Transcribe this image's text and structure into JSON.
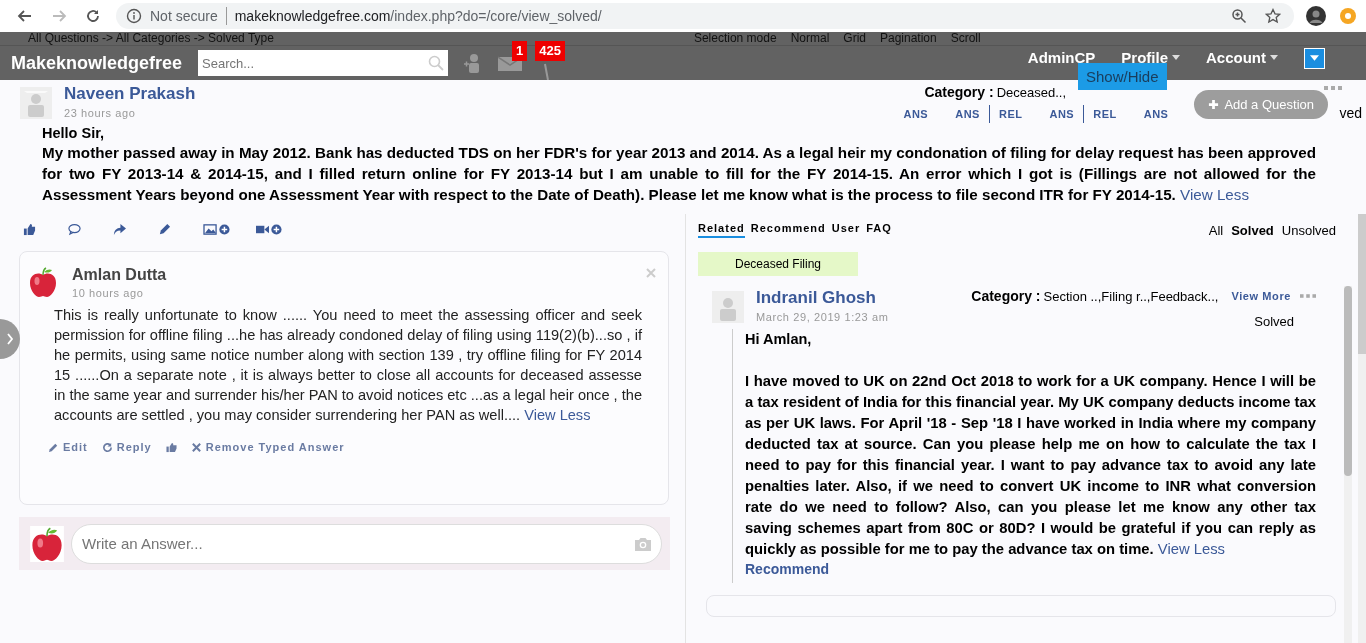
{
  "browser": {
    "security": "Not secure",
    "url_host": "makeknowledgefree.com",
    "url_path": "/index.php?do=/core/view_solved/"
  },
  "navbar": {
    "breadcrumb": "All Questions -> All Categories -> Solved Type",
    "view_options": [
      "Selection mode",
      "Normal",
      "Grid",
      "Pagination",
      "Scroll"
    ],
    "brand": "Makeknowledgefree",
    "search": {
      "placeholder": "Search..."
    },
    "badges": [
      "1",
      "425"
    ],
    "menu": [
      {
        "label": "AdminCP",
        "dropdown": false
      },
      {
        "label": "Profile",
        "dropdown": true
      },
      {
        "label": "Account",
        "dropdown": true
      }
    ],
    "show_hide": "Show/Hide"
  },
  "question": {
    "author": "Naveen Prakash",
    "time": "23 hours ago",
    "category_label": "Category :",
    "category": "Deceased..,",
    "links": [
      {
        "label": "ANS",
        "divider": false
      },
      {
        "label": "ANS",
        "divider": false
      },
      {
        "label": "REL",
        "divider": true
      },
      {
        "label": "ANS",
        "divider": false
      },
      {
        "label": "REL",
        "divider": true
      },
      {
        "label": "ANS",
        "divider": false
      }
    ],
    "status": "ved",
    "greeting": "Hello Sir,",
    "body": "My mother passed away in May 2012. Bank has deducted TDS on her FDR's for year 2013 and 2014. As a legal heir my condonation of filing for delay request has been approved for two FY 2013-14 & 2014-15, and I filled return online for FY 2013-14 but I am unable to fill for the FY 2014-15. An error which I got is (Fillings are not allowed for the Assessment Years beyond one Assessment Year with respect to the Date of Death). Please let me know what is the process to file second ITR for FY 2014-15.",
    "view_less": "View Less"
  },
  "add_question": "Add a Question",
  "answer": {
    "author": "Amlan Dutta",
    "time": "10 hours ago",
    "body": "This is really unfortunate to know ...... You need to meet the assessing officer and seek permission for offline filing ...he has already condoned delay of filing using 119(2)(b)...so , if he permits, using same notice number along with section 139 , try offline filing for FY 2014 15 ......On a separate note , it is always better to close all accounts for deceased assesse in the same year and surrender his/her PAN to avoid notices etc ...as a legal heir once , the accounts are settled , you may consider surrendering her PAN as well....",
    "view_less": "View Less",
    "actions": [
      {
        "kind": "edit",
        "label": "Edit"
      },
      {
        "kind": "reply",
        "label": "Reply"
      },
      {
        "kind": "like"
      },
      {
        "kind": "remove",
        "label": "Remove Typed Answer"
      }
    ]
  },
  "answer_box": {
    "placeholder": "Write an Answer..."
  },
  "tabs": [
    {
      "label": "Related",
      "selected": true
    },
    {
      "label": "Recommend",
      "selected": false
    },
    {
      "label": "User",
      "selected": false
    },
    {
      "label": "FAQ",
      "selected": false
    }
  ],
  "filters": [
    {
      "label": "All",
      "selected": false
    },
    {
      "label": "Solved",
      "selected": true
    },
    {
      "label": "Unsolved",
      "selected": false
    }
  ],
  "tag": "Deceased Filing",
  "related": {
    "author": "Indranil Ghosh",
    "date": "March 29, 2019 1:23 am",
    "category_label": "Category :",
    "category": "Section ..,Filing r..,Feedback..,",
    "view_more": "View More",
    "status": "Solved",
    "greeting": "Hi Amlan,",
    "body": "I have moved to UK on 22nd Oct 2018 to work for a UK company. Hence I will be a tax resident of India for this financial year. My UK company deducts income tax as per UK laws. For April '18 - Sep '18 I have worked in India where my company deducted tax at source. Can you please help me on how to calculate the tax I need to pay for this financial year. I want to pay advance tax to avoid any late penalties later. Also, if we need to convert UK income to INR what conversion rate do we need to follow? Also, can you please let me know any other tax saving schemes apart from 80C or 80D? I would be grateful if you can reply as quickly as possible for me to pay the advance tax on time.",
    "view_less": "View Less",
    "recommend": "Recommend"
  }
}
